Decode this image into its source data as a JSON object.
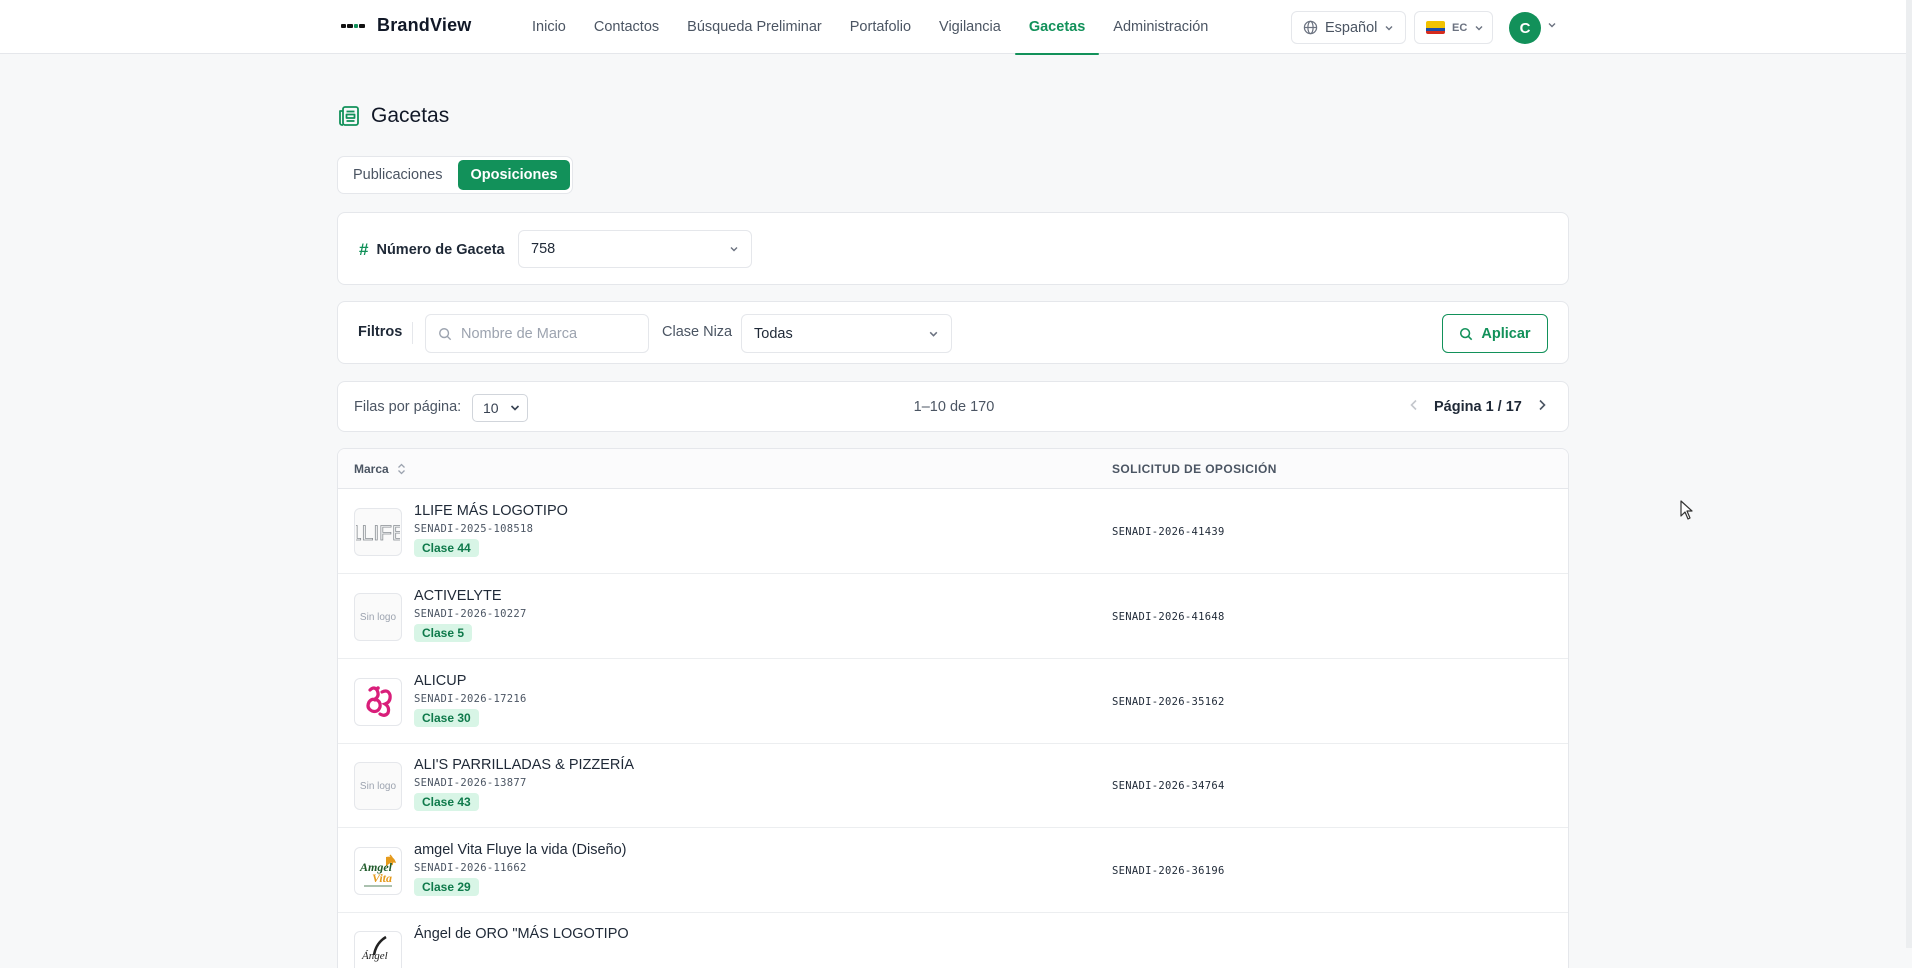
{
  "brand": {
    "name": "BrandView"
  },
  "nav": {
    "items": [
      {
        "label": "Inicio"
      },
      {
        "label": "Contactos"
      },
      {
        "label": "Búsqueda Preliminar"
      },
      {
        "label": "Portafolio"
      },
      {
        "label": "Vigilancia"
      },
      {
        "label": "Gacetas",
        "active": true
      },
      {
        "label": "Administración"
      }
    ]
  },
  "header": {
    "language": "Español",
    "country": "EC",
    "avatar_initial": "C"
  },
  "page": {
    "title": "Gacetas"
  },
  "tabs": [
    {
      "label": "Publicaciones",
      "active": false
    },
    {
      "label": "Oposiciones",
      "active": true
    }
  ],
  "gaceta": {
    "label": "Número de Gaceta",
    "value": "758"
  },
  "filters": {
    "label": "Filtros",
    "search_placeholder": "Nombre de Marca",
    "niza_label": "Clase Niza",
    "niza_value": "Todas",
    "apply_label": "Aplicar"
  },
  "pagination": {
    "rows_label": "Filas por página:",
    "rows_value": "10",
    "range_text": "1–10 de 170",
    "page_text": "Página 1 / 17"
  },
  "table": {
    "columns": {
      "marca": "Marca",
      "solicitud": "SOLICITUD DE OPOSICIÓN"
    },
    "rows": [
      {
        "name": "1LIFE MÁS LOGOTIPO",
        "app": "SENADI-2025-108518",
        "clase": "Clase 44",
        "solicitud": "SENADI-2026-41439",
        "logo": "1life"
      },
      {
        "name": "ACTIVELYTE",
        "app": "SENADI-2026-10227",
        "clase": "Clase 5",
        "solicitud": "SENADI-2026-41648",
        "logo": "none",
        "logo_text": "Sin logo"
      },
      {
        "name": "ALICUP",
        "app": "SENADI-2026-17216",
        "clase": "Clase 30",
        "solicitud": "SENADI-2026-35162",
        "logo": "alicup"
      },
      {
        "name": "ALI'S PARRILLADAS & PIZZERÍA",
        "app": "SENADI-2026-13877",
        "clase": "Clase 43",
        "solicitud": "SENADI-2026-34764",
        "logo": "none",
        "logo_text": "Sin logo"
      },
      {
        "name": "amgel Vita Fluye la vida (Diseño)",
        "app": "SENADI-2026-11662",
        "clase": "Clase 29",
        "solicitud": "SENADI-2026-36196",
        "logo": "amgel"
      },
      {
        "name": "Ángel de ORO \"MÁS LOGOTIPO",
        "app": "",
        "clase": "",
        "solicitud": "",
        "logo": "angel"
      }
    ]
  },
  "colors": {
    "accent": "#12915a",
    "badge_bg": "#d8f5e6"
  }
}
